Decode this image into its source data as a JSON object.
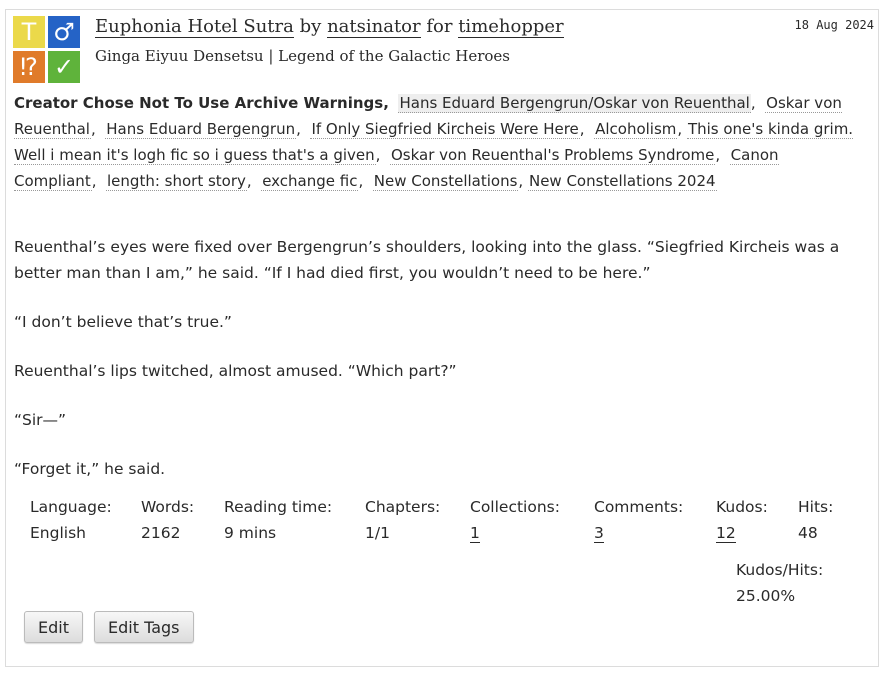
{
  "work": {
    "title": "Euphonia Hotel Sutra",
    "by": "by",
    "author": "natsinator",
    "for": "for",
    "recipient": "timehopper",
    "fandom": "Ginga Eiyuu Densetsu | Legend of the Galactic Heroes",
    "date": "18 Aug 2024"
  },
  "icons": {
    "rating": {
      "name": "teen-rating-icon",
      "glyph": "T",
      "color": "#ebd94a"
    },
    "category": {
      "name": "mm-category-icon",
      "glyph": "♂",
      "color": "#2563c6"
    },
    "warning": {
      "name": "archive-warning-icon",
      "glyph": "⁉",
      "color": "#e07b2a"
    },
    "status": {
      "name": "complete-status-icon",
      "glyph": "✓",
      "color": "#5fb33b"
    }
  },
  "tags": {
    "warning": "Creator Chose Not To Use Archive Warnings,",
    "items": [
      "Hans Eduard Bergengrun/Oskar von Reuenthal",
      "Oskar von Reuenthal",
      "Hans Eduard Bergengrun",
      "If Only Siegfried Kircheis Were Here",
      "Alcoholism",
      "This one's kinda grim. Well i mean it's logh fic so i guess that's a given",
      "Oskar von Reuenthal's Problems Syndrome",
      "Canon Compliant",
      "length: short story",
      "exchange fic",
      "New Constellations",
      "New Constellations 2024"
    ]
  },
  "summary": [
    "Reuenthal’s eyes were fixed over Bergengrun’s shoulders, looking into the glass. “Siegfried Kircheis was a better man than I am,” he said. “If I had died first, you wouldn’t need to be here.”",
    "“I don’t believe that’s true.”",
    "Reuenthal’s lips twitched, almost amused. “Which part?”",
    "“Sir—”",
    "“Forget it,” he said."
  ],
  "stats": {
    "language": {
      "label": "Language:",
      "value": "English"
    },
    "words": {
      "label": "Words:",
      "value": "2162"
    },
    "reading_time": {
      "label": "Reading time:",
      "value": "9 mins"
    },
    "chapters": {
      "label": "Chapters:",
      "value": "1/1"
    },
    "collections": {
      "label": "Collections:",
      "value": "1"
    },
    "comments": {
      "label": "Comments:",
      "value": "3"
    },
    "kudos": {
      "label": "Kudos:",
      "value": "12"
    },
    "hits": {
      "label": "Hits:",
      "value": "48"
    },
    "kudos_hits": {
      "label": "Kudos/Hits:",
      "value": "25.00%"
    }
  },
  "buttons": {
    "edit": "Edit",
    "edit_tags": "Edit Tags"
  }
}
